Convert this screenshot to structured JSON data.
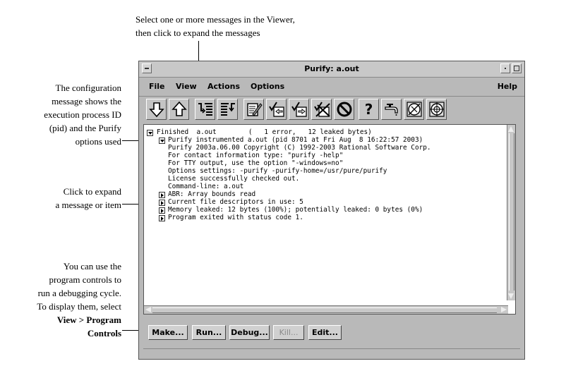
{
  "callouts": {
    "top": [
      "Select one or more messages in the Viewer,",
      "then click to expand the messages"
    ],
    "config": [
      "The configuration",
      "message shows the",
      "execution process ID",
      "(pid) and the Purify",
      "options used"
    ],
    "expand": [
      "Click to expand",
      "a message or item"
    ],
    "controls": [
      "You can use the",
      "program controls to",
      "run a debugging cycle.",
      "To display them, select",
      "View > Program",
      "Controls"
    ]
  },
  "window": {
    "title": "Purify: a.out"
  },
  "menus": {
    "file": "File",
    "view": "View",
    "actions": "Actions",
    "options": "Options",
    "help": "Help"
  },
  "toolbar_icons": [
    "arrow-down-icon",
    "arrow-up-icon",
    "expand-messages-icon",
    "collapse-messages-icon",
    "edit-source-icon",
    "suppress-icon",
    "unsuppress-icon",
    "kill-suppressions-icon",
    "stop-icon",
    "help-question-icon",
    "faucet-icon",
    "watchpoint-icon",
    "target-icon"
  ],
  "toolbar_help_glyph": "?",
  "viewer_lines": [
    "Finished  a.out        (   1 error,   12 leaked bytes)",
    "Purify instrumented a.out (pid 8701 at Fri Aug  8 16:22:57 2003)",
    "Purify 2003a.06.00 Copyright (C) 1992-2003 Rational Software Corp.",
    "For contact information type: \"purify -help\"",
    "For TTY output, use the option \"-windows=no\"",
    "Options settings: -purify -purify-home=/usr/pure/purify",
    "License successfully checked out.",
    "Command-line: a.out",
    "ABR: Array bounds read",
    "Current file descriptors in use: 5",
    "Memory leaked: 12 bytes (100%); potentially leaked: 0 bytes (0%)",
    "Program exited with status code 1."
  ],
  "program_controls": {
    "make": "Make...",
    "run": "Run...",
    "debug": "Debug...",
    "kill": "Kill...",
    "edit": "Edit..."
  }
}
